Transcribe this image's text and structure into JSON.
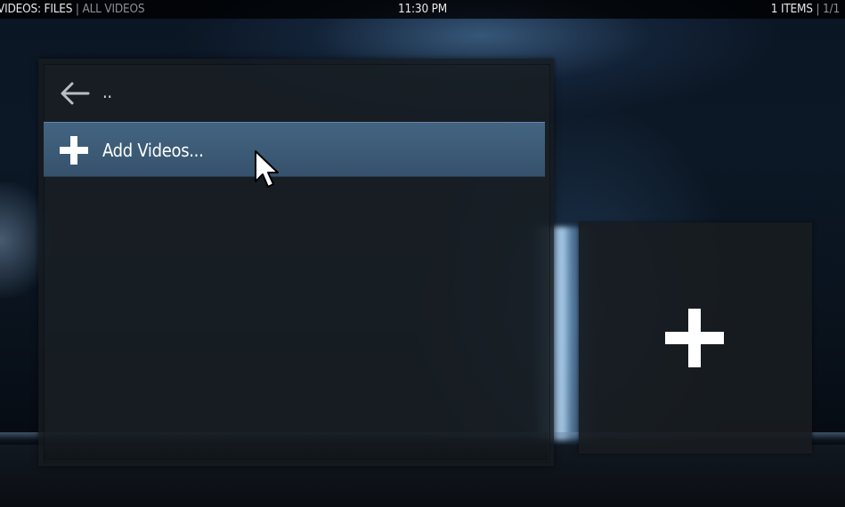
{
  "header": {
    "section": "VIDEOS: FILES",
    "separator": "|",
    "subsection": "ALL VIDEOS",
    "clock": "11:30 PM",
    "item_count": "1 ITEMS",
    "page_separator": "|",
    "page": "1/1"
  },
  "list": {
    "items": [
      {
        "label": "..",
        "icon": "back-arrow-icon"
      },
      {
        "label": "Add Videos...",
        "icon": "plus-icon",
        "focused": true
      }
    ]
  },
  "preview": {
    "icon": "plus-icon"
  },
  "colors": {
    "focus_highlight": "#486c8c",
    "text_primary": "#ffffff",
    "text_secondary": "#8a8f94",
    "panel_bg": "#161b20"
  }
}
